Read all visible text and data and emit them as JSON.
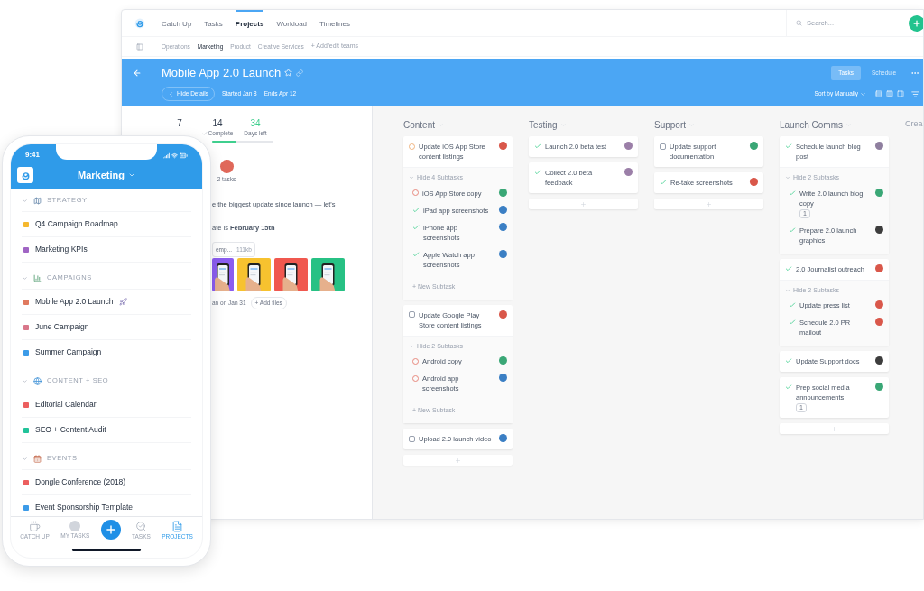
{
  "app": {
    "nav_tabs": [
      {
        "label": "Catch Up",
        "selected": false
      },
      {
        "label": "Tasks",
        "selected": false
      },
      {
        "label": "Projects",
        "selected": true
      },
      {
        "label": "Workload",
        "selected": false
      },
      {
        "label": "Timelines",
        "selected": false
      }
    ],
    "search": {
      "placeholder": "Search..."
    },
    "teams": [
      {
        "label": "Operations",
        "selected": false
      },
      {
        "label": "Marketing",
        "selected": true
      },
      {
        "label": "Product",
        "selected": false
      },
      {
        "label": "Creative Services",
        "selected": false
      }
    ],
    "add_teams": "+ Add/edit teams"
  },
  "project": {
    "title": "Mobile App 2.0 Launch",
    "views": [
      {
        "label": "Tasks",
        "selected": true
      },
      {
        "label": "Schedule",
        "selected": false
      }
    ],
    "hide_details": "Hide Details",
    "started": "Started Jan 8",
    "ends": "Ends Apr 12",
    "sort": "Sort by Manually"
  },
  "details": {
    "stats": [
      {
        "value": "7",
        "highlight": false
      },
      {
        "value": "14",
        "label": "Complete",
        "highlight": false
      },
      {
        "value": "34",
        "label": "Days left",
        "highlight": true
      }
    ],
    "progress": {
      "level": 0.4
    },
    "assignee": {
      "color": "#e0685a",
      "caption": "2 tasks"
    },
    "description": [
      "e the biggest update since launch — let's",
      "ate is **February 15th**"
    ],
    "attachment": {
      "name": "emp...",
      "size": "111kb"
    },
    "images": [
      {
        "kind": "picture",
        "color": "#8b5cf0"
      },
      {
        "kind": "picture",
        "color": "#f7c22f"
      },
      {
        "kind": "picture",
        "color": "#f0584f"
      },
      {
        "kind": "picture",
        "color": "#27c184"
      }
    ],
    "footer": "an on Jan 31",
    "add_files": "+ Add files"
  },
  "columns": [
    {
      "title": "Content",
      "add_button": true,
      "tasks": [
        {
          "text": "Update iOS App Store content listings",
          "kind": "in-progress",
          "color": "#d9574a",
          "subtasks_label": "Hide 4 Subtasks",
          "subtasks": [
            {
              "text": "iOS App Store copy",
              "kind": "not-started",
              "color": "#3aa776"
            },
            {
              "text": "iPad app screenshots",
              "kind": "done",
              "color": "#3b7fc4"
            },
            {
              "text": "iPhone app screenshots",
              "kind": "done",
              "color": "#3b7fc4"
            },
            {
              "text": "Apple Watch app screenshots",
              "kind": "done",
              "color": "#3b7fc4"
            }
          ],
          "new_subtask": "+ New Subtask"
        },
        {
          "text": "Update Google Play Store content listings",
          "kind": "checkbox",
          "color": "#d9574a",
          "subtasks_label": "Hide 2 Subtasks",
          "subtasks": [
            {
              "text": "Android copy",
              "kind": "not-started",
              "color": "#3aa776"
            },
            {
              "text": "Android app screenshots",
              "kind": "not-started",
              "color": "#3b7fc4"
            }
          ],
          "new_subtask": "+ New Subtask"
        },
        {
          "text": "Upload 2.0 launch video",
          "kind": "checkbox",
          "color": "#3b7fc4"
        }
      ]
    },
    {
      "title": "Testing",
      "add_button": true,
      "tasks": [
        {
          "text": "Launch 2.0 beta test",
          "kind": "done",
          "color": "#9b7fa8"
        },
        {
          "text": "Collect 2.0 beta feedback",
          "kind": "done",
          "color": "#9b7fa8"
        }
      ]
    },
    {
      "title": "Support",
      "add_button": true,
      "tasks": [
        {
          "text": "Update support documentation",
          "kind": "checkbox",
          "color": "#3aa776"
        },
        {
          "text": "Re-take screenshots",
          "kind": "done",
          "color": "#d9574a"
        }
      ]
    },
    {
      "title": "Launch Comms",
      "add_button": true,
      "tasks": [
        {
          "text": "Schedule launch blog post",
          "kind": "done",
          "color": "#8f7f9f",
          "subtasks_label": "Hide 2 Subtasks",
          "subtasks": [
            {
              "text": "Write 2.0 launch blog copy",
              "kind": "done",
              "color": "#3aa776",
              "comments": "1"
            },
            {
              "text": "Prepare 2.0 launch graphics",
              "kind": "done",
              "color": "#3d3d3d"
            }
          ]
        },
        {
          "text": "2.0 Journalist outreach",
          "kind": "done",
          "color": "#d9574a",
          "subtasks_label": "Hide 2 Subtasks",
          "subtasks": [
            {
              "text": "Update press list",
              "kind": "done",
              "color": "#d9574a"
            },
            {
              "text": "Schedule 2.0 PR mailout",
              "kind": "done",
              "color": "#d9574a"
            }
          ]
        },
        {
          "text": "Update Support docs",
          "kind": "done",
          "color": "#3d3d3d"
        },
        {
          "text": "Prep social media announcements",
          "kind": "done",
          "color": "#3aa776",
          "comments": "1"
        }
      ]
    },
    {
      "title": "Crea"
    }
  ],
  "phone": {
    "time": "9:41",
    "title": "Marketing",
    "sections": [
      {
        "label": "STRATEGY",
        "kind": "map",
        "items": [
          {
            "label": "Q4 Campaign Roadmap",
            "color": "#f5b82e"
          },
          {
            "label": "Marketing KPIs",
            "color": "#a065c4"
          }
        ]
      },
      {
        "label": "CAMPAIGNS",
        "kind": "chart",
        "items": [
          {
            "label": "Mobile App 2.0 Launch",
            "color": "#e07a5f",
            "rocket": true
          },
          {
            "label": "June Campaign",
            "color": "#d9778a"
          },
          {
            "label": "Summer Campaign",
            "color": "#3c9be8"
          }
        ]
      },
      {
        "label": "CONTENT + SEO",
        "kind": "globe",
        "items": [
          {
            "label": "Editorial Calendar",
            "color": "#ec5f5f"
          },
          {
            "label": "SEO + Content Audit",
            "color": "#22c39a"
          }
        ]
      },
      {
        "label": "EVENTS",
        "kind": "calendar",
        "items": [
          {
            "label": "Dongle Conference (2018)",
            "color": "#ec5f5f"
          },
          {
            "label": "Event Sponsorship Template",
            "color": "#3c9be8"
          }
        ]
      }
    ],
    "tabs": [
      {
        "label": "CATCH UP",
        "kind": "cup",
        "selected": false
      },
      {
        "label": "MY TASKS",
        "kind": "avatar",
        "selected": false
      },
      {
        "kind": "add",
        "selected": false
      },
      {
        "label": "TASKS",
        "kind": "search",
        "selected": false
      },
      {
        "label": "PROJECTS",
        "kind": "list",
        "selected": true
      }
    ]
  }
}
